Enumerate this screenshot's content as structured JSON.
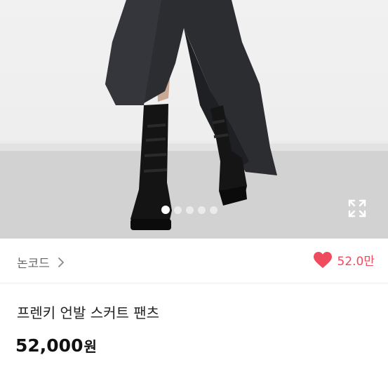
{
  "gallery": {
    "image_count": 5,
    "current_index": 1,
    "expand_icon": "expand-icon"
  },
  "seller": {
    "name": "논코드",
    "chevron_icon": "chevron-right-icon"
  },
  "likes": {
    "count": "52.0만",
    "heart_icon": "heart-icon",
    "color": "#ef4b5f"
  },
  "product": {
    "title": "프렌키 언발 스커트 팬츠",
    "price": "52,000",
    "currency": "원"
  }
}
